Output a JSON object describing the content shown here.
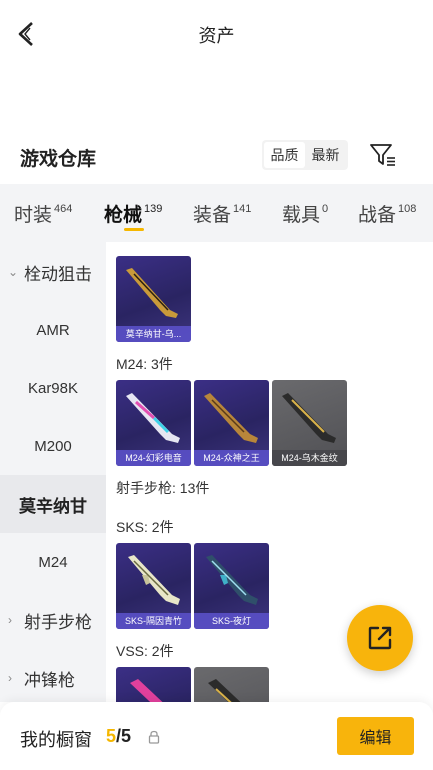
{
  "header": {
    "title": "资产"
  },
  "warehouse": {
    "title": "游戏仓库",
    "sort_options": [
      "品质",
      "最新"
    ]
  },
  "tabs": [
    {
      "label": "时装",
      "count": "464"
    },
    {
      "label": "枪械",
      "count": "139"
    },
    {
      "label": "装备",
      "count": "141"
    },
    {
      "label": "载具",
      "count": "0"
    },
    {
      "label": "战备",
      "count": "108"
    }
  ],
  "sidebar": [
    {
      "label": "栓动狙击",
      "type": "group",
      "chevron": "⌄"
    },
    {
      "label": "AMR",
      "type": "item"
    },
    {
      "label": "Kar98K",
      "type": "item"
    },
    {
      "label": "M200",
      "type": "item"
    },
    {
      "label": "莫辛纳甘",
      "type": "item"
    },
    {
      "label": "M24",
      "type": "item"
    },
    {
      "label": "射手步枪",
      "type": "group",
      "chevron": "›"
    },
    {
      "label": "冲锋枪",
      "type": "group",
      "chevron": "›"
    }
  ],
  "content": {
    "sections": [
      {
        "label": "M24: 3件"
      },
      {
        "label": "射手步枪: 13件"
      },
      {
        "label": "SKS: 2件"
      },
      {
        "label": "VSS: 2件"
      }
    ],
    "cards": [
      {
        "caption": "莫辛纳甘-乌..."
      },
      {
        "caption": "M24-幻彩电音"
      },
      {
        "caption": "M24-众神之王"
      },
      {
        "caption": "M24-乌木金纹"
      },
      {
        "caption": "SKS-隔因青竹"
      },
      {
        "caption": "SKS-夜灯"
      }
    ]
  },
  "bottom": {
    "label": "我的橱窗",
    "current": "5",
    "separator": "/",
    "total": "5",
    "edit_label": "编辑"
  },
  "colors": {
    "accent": "#f8b40c",
    "card_purple": "#2f2870",
    "card_gray": "#5c5c60"
  }
}
